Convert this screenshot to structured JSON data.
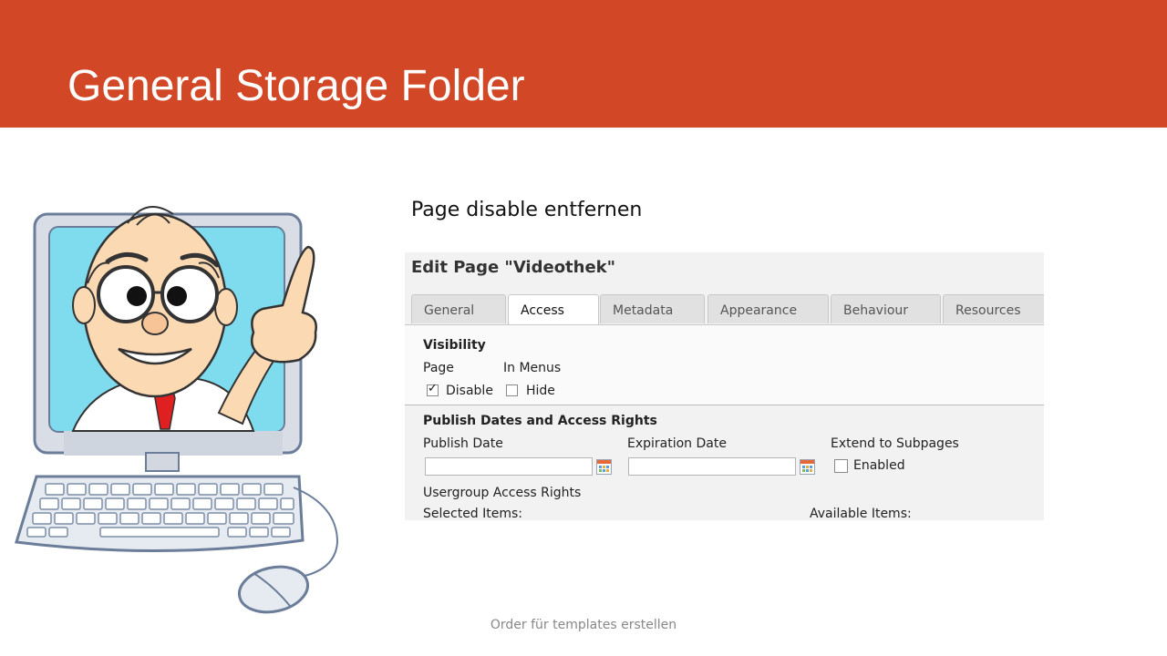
{
  "slide": {
    "title": "General Storage Folder",
    "subtitle": "Page disable entfernen",
    "footer": "Order für templates erstellen",
    "accent_color": "#d24726"
  },
  "cartoon": {
    "icon": "cartoon-computer-man-pointing-icon"
  },
  "editor": {
    "heading": "Edit Page \"Videothek\"",
    "tabs": [
      {
        "label": "General",
        "active": false
      },
      {
        "label": "Access",
        "active": true
      },
      {
        "label": "Metadata",
        "active": false
      },
      {
        "label": "Appearance",
        "active": false
      },
      {
        "label": "Behaviour",
        "active": false
      },
      {
        "label": "Resources",
        "active": false
      }
    ],
    "visibility": {
      "heading": "Visibility",
      "page_label": "Page",
      "menus_label": "In Menus",
      "disable_label": "Disable",
      "disable_checked": true,
      "hide_label": "Hide",
      "hide_checked": false
    },
    "publish": {
      "heading": "Publish Dates and Access Rights",
      "publish_date_label": "Publish Date",
      "publish_date_value": "",
      "expiration_date_label": "Expiration Date",
      "expiration_date_value": "",
      "extend_label": "Extend to Subpages",
      "enabled_label": "Enabled",
      "enabled_checked": false,
      "usergroup_label": "Usergroup Access Rights",
      "selected_items_label": "Selected Items:",
      "available_items_label": "Available Items:"
    }
  }
}
